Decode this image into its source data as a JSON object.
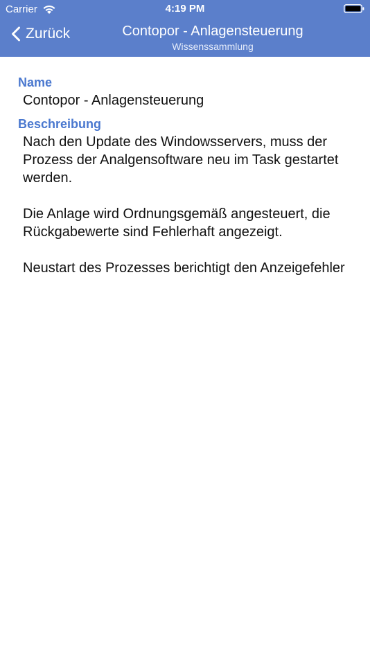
{
  "status_bar": {
    "carrier": "Carrier",
    "time": "4:19 PM"
  },
  "nav": {
    "back_label": "Zurück",
    "title": "Contopor - Anlagensteuerung",
    "subtitle": "Wissenssammlung"
  },
  "fields": {
    "name_label": "Name",
    "name_value": "Contopor - Anlagensteuerung",
    "description_label": "Beschreibung",
    "description_paragraphs": [
      "Nach den Update des Windowsservers, muss der Prozess der Analgensoftware neu im Task gestartet werden.",
      "Die Anlage wird Ordnungsgemäß angesteuert, die Rückgabewerte sind Fehlerhaft angezeigt.",
      "Neustart des Prozesses berichtigt den Anzeigefehler"
    ]
  },
  "colors": {
    "header_bg": "#5b7fcb",
    "label_blue": "#4a78cf"
  },
  "icons": {
    "wifi": "wifi-icon",
    "battery": "battery-icon",
    "back": "chevron-left-icon"
  }
}
